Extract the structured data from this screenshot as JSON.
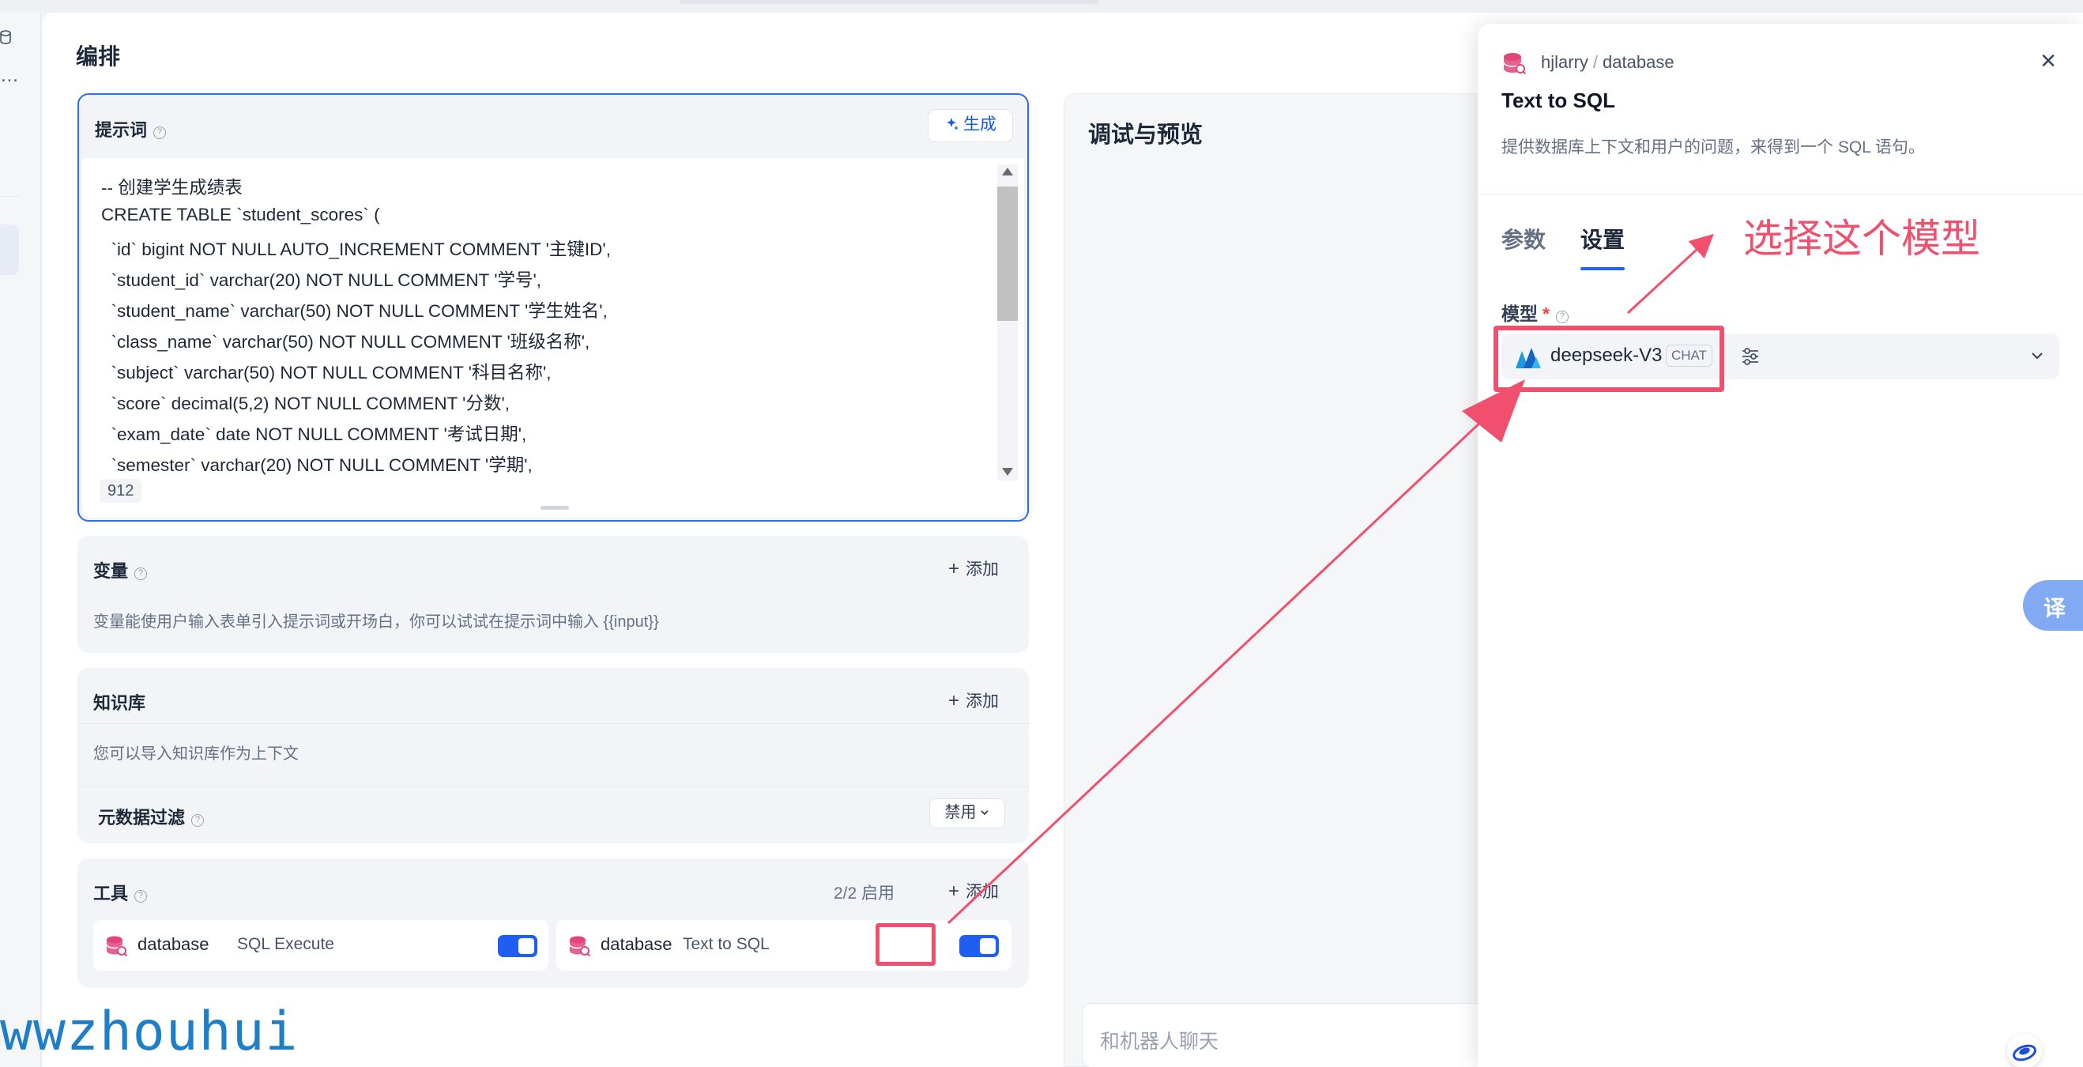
{
  "editor_section": {
    "title": "编排"
  },
  "prompt": {
    "title": "提示词",
    "generate_label": "生成",
    "lines": [
      "-- 创建学生成绩表",
      "CREATE TABLE `student_scores` (",
      "  `id` bigint NOT NULL AUTO_INCREMENT COMMENT '主键ID',",
      "  `student_id` varchar(20) NOT NULL COMMENT '学号',",
      "  `student_name` varchar(50) NOT NULL COMMENT '学生姓名',",
      "  `class_name` varchar(50) NOT NULL COMMENT '班级名称',",
      "  `subject` varchar(50) NOT NULL COMMENT '科目名称',",
      "  `score` decimal(5,2) NOT NULL COMMENT '分数',",
      "  `exam_date` date NOT NULL COMMENT '考试日期',",
      "  `semester` varchar(20) NOT NULL COMMENT '学期',"
    ],
    "char_count": "912"
  },
  "variables": {
    "title": "变量",
    "add_label": "添加",
    "description": "变量能使用户输入表单引入提示词或开场白，你可以试试在提示词中输入 {{input}}"
  },
  "knowledge": {
    "title": "知识库",
    "add_label": "添加",
    "description": "您可以导入知识库作为上下文",
    "metadata_filter_label": "元数据过滤",
    "metadata_filter_value": "禁用"
  },
  "tools": {
    "title": "工具",
    "count_label": "2/2 启用",
    "add_label": "添加",
    "items": [
      {
        "provider": "database",
        "name": "SQL Execute",
        "enabled": true
      },
      {
        "provider": "database",
        "name": "Text to SQL",
        "enabled": true
      }
    ]
  },
  "debug": {
    "title": "调试与预览",
    "chat_placeholder": "和机器人聊天"
  },
  "drawer": {
    "breadcrumb_user": "hjlarry",
    "breadcrumb_sep": "/",
    "breadcrumb_provider": "database",
    "title": "Text to SQL",
    "description": "提供数据库上下文和用户的问题，来得到一个 SQL 语句。",
    "tabs": [
      {
        "label": "参数",
        "active": false
      },
      {
        "label": "设置",
        "active": true
      }
    ],
    "model_label": "模型",
    "required_mark": "*",
    "model_name": "deepseek-V3",
    "model_badge": "CHAT"
  },
  "annotation": {
    "text": "选择这个模型",
    "color": "#f0506e"
  },
  "translate_button": "译",
  "watermark": "wwzhouhui",
  "colors": {
    "accent": "#2563eb",
    "toggle_on": "#1f5ef0",
    "annotation_red": "#f0506e",
    "tool_icon_pink": "#e0457b"
  }
}
